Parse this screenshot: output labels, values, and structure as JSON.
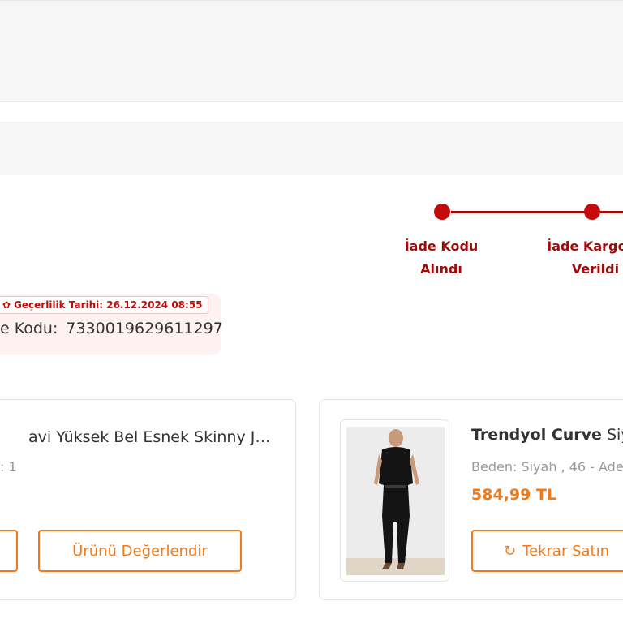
{
  "tracker": {
    "steps": [
      {
        "label_line1": "İade Kodu",
        "label_line2": "Alındı"
      },
      {
        "label_line1": "İade Kargoya",
        "label_line2": "Verildi"
      }
    ]
  },
  "return_code": {
    "validity": "Geçerlilik Tarihi: 26.12.2024 08:55",
    "label": "e Kodu:",
    "value": "7330019629611297"
  },
  "products": [
    {
      "title": "avi Yüksek Bel Esnek Skinny Jean…",
      "quantity": ": 1",
      "button_partial": "",
      "review_button": "Ürünü Değerlendir"
    },
    {
      "brand": "Trendyol Curve",
      "title_rest": "Siy",
      "variant": "Beden: Siyah , 46 - Ade",
      "price": "584,99 TL",
      "rebuy_button": "Tekrar Satın",
      "image_alt": "black jumpsuit product photo"
    }
  ],
  "colors": {
    "accent": "#f27a1a",
    "tracker_red": "#a20a0a",
    "code_bg": "#fdf1f1"
  },
  "icons": {
    "validity": "gear-icon",
    "rebuy": "refresh-icon"
  }
}
